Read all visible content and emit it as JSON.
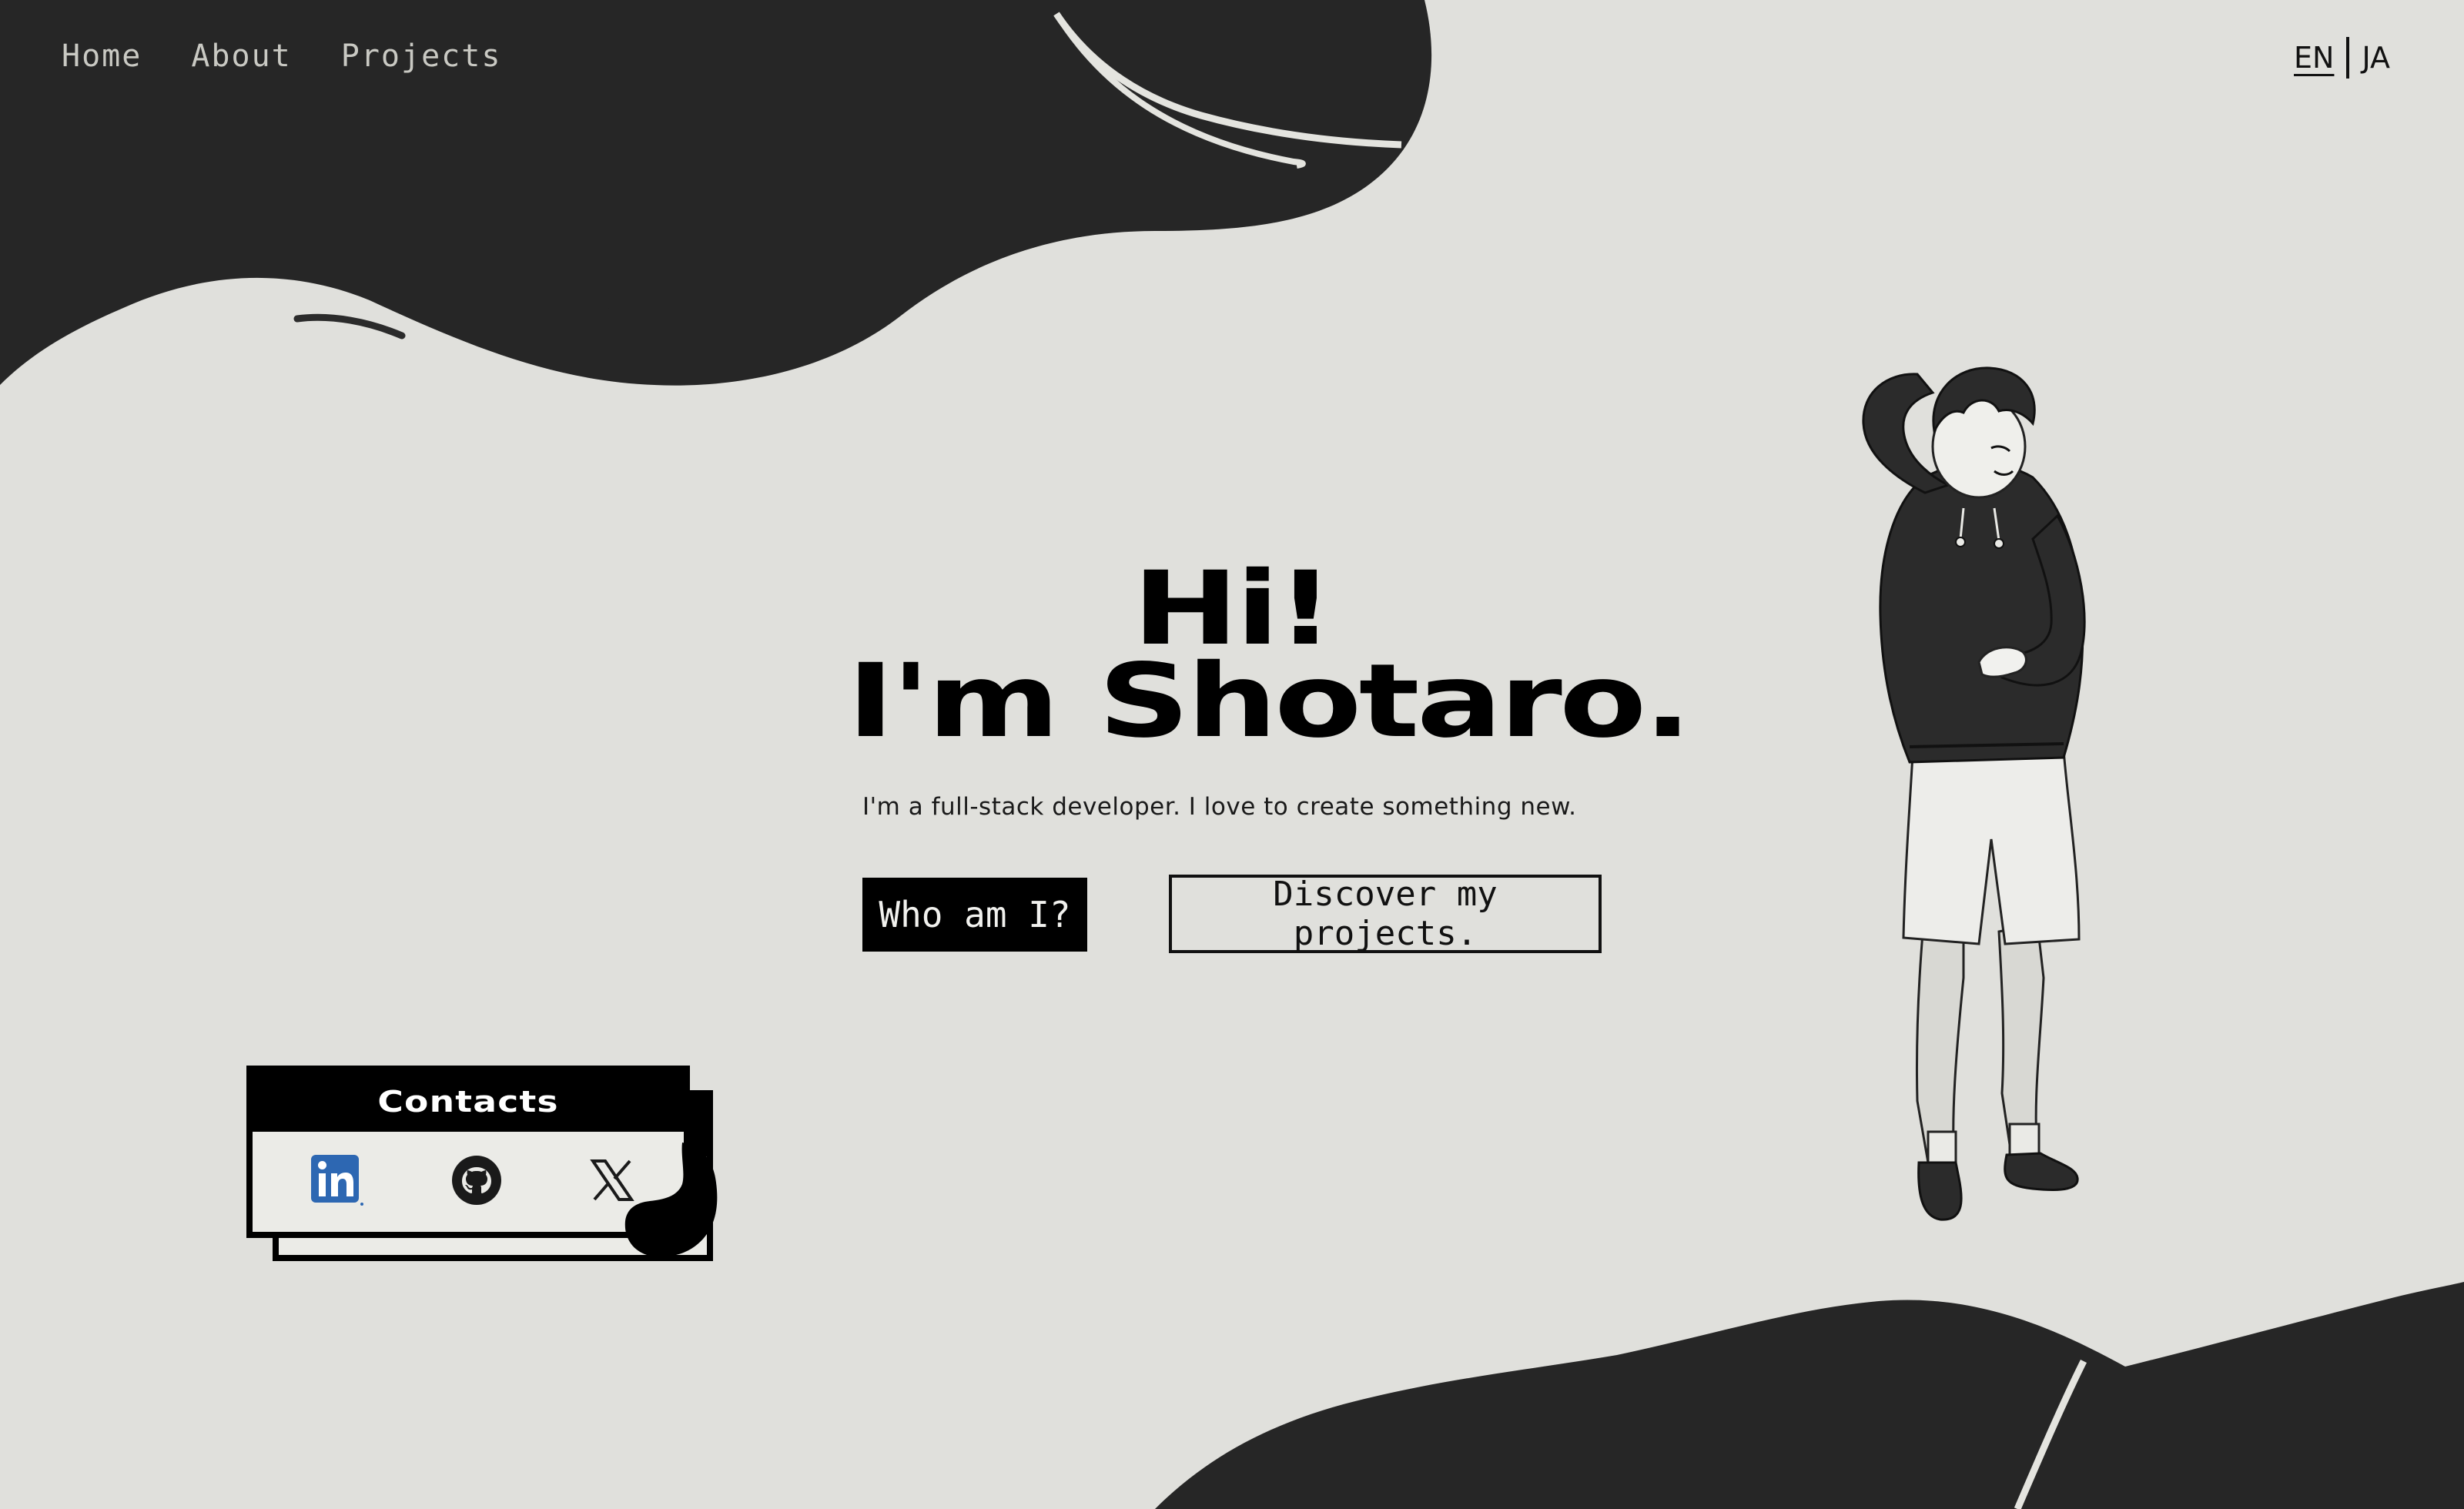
{
  "nav": {
    "links": [
      {
        "label": "Home"
      },
      {
        "label": "About"
      },
      {
        "label": "Projects"
      }
    ]
  },
  "language": {
    "options": [
      "EN",
      "JA"
    ],
    "selected": "EN"
  },
  "hero": {
    "title_line1": "Hi!",
    "title_line2": "I'm Shotaro.",
    "subtitle": "I'm a full-stack developer. I love to create something new.",
    "primary_button": "Who am I?",
    "secondary_button": "Discover my projects."
  },
  "contacts": {
    "title": "Contacts",
    "links": [
      {
        "icon": "linkedin-icon"
      },
      {
        "icon": "github-icon"
      },
      {
        "icon": "x-icon"
      }
    ]
  },
  "colors": {
    "background": "#e0e0dc",
    "dark_blob": "#2b2b2b",
    "text": "#111111",
    "nav_text": "#c9c9c3",
    "linkedin_blue": "#2d67b2"
  }
}
